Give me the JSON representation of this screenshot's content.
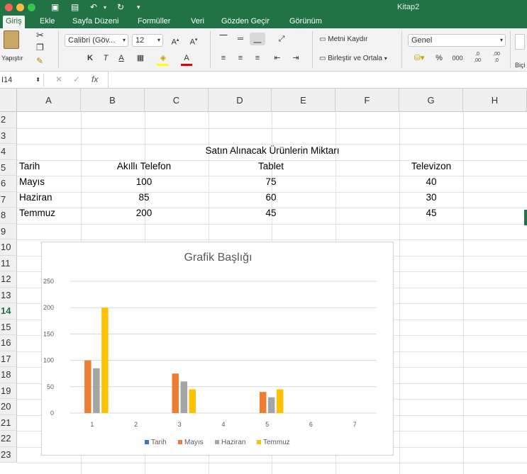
{
  "window": {
    "title": "Kitap2"
  },
  "tabs": [
    "Giriş",
    "Ekle",
    "Sayfa Düzeni",
    "Formüller",
    "Veri",
    "Gözden Geçir",
    "Görünüm"
  ],
  "ribbon": {
    "paste_label": "Yapıştır",
    "font_name": "Calibri (Göv...",
    "font_size": "12",
    "bold": "K",
    "italic": "T",
    "underline": "A",
    "wrap_text": "Metni Kaydır",
    "merge_center": "Birleştir ve Ortala",
    "number_format": "Genel",
    "percent": "%",
    "thousands": "000",
    "decimals_inc": ",0\n,00",
    "decimals_dec": ",00\n,0",
    "styles_label": "Biçi"
  },
  "formula_bar": {
    "name_box": "I14",
    "fx": "fx",
    "content": ""
  },
  "columns": [
    "A",
    "B",
    "C",
    "D",
    "E",
    "F",
    "G",
    "H"
  ],
  "rows": [
    "2",
    "3",
    "4",
    "5",
    "6",
    "7",
    "8",
    "9",
    "10",
    "11",
    "12",
    "13",
    "14",
    "15",
    "16",
    "17",
    "18",
    "19",
    "20",
    "21",
    "22",
    "23"
  ],
  "selected_row": "14",
  "table": {
    "title": "Satın Alınacak Ürünlerin Miktarı",
    "headers": [
      "Tarih",
      "Akıllı Telefon",
      "Tablet",
      "Televizon"
    ],
    "data": [
      [
        "Mayıs",
        "100",
        "75",
        "40"
      ],
      [
        "Haziran",
        "85",
        "60",
        "30"
      ],
      [
        "Temmuz",
        "200",
        "45",
        "45"
      ]
    ]
  },
  "colors": {
    "excel_green": "#217346",
    "tarih": "#4472C4",
    "mayis": "#ED7D31",
    "haziran": "#A5A5A5",
    "temmuz": "#FFC000"
  },
  "chart_data": {
    "type": "bar",
    "title": "Grafik Başlığı",
    "categories": [
      "1",
      "2",
      "3",
      "4",
      "5",
      "6",
      "7"
    ],
    "ylim": [
      0,
      250
    ],
    "yticks": [
      0,
      50,
      100,
      150,
      200,
      250
    ],
    "grid": true,
    "legend_position": "bottom",
    "series": [
      {
        "name": "Tarih",
        "color": "#4472C4",
        "values": [
          0,
          0,
          0,
          0,
          0,
          0,
          0
        ]
      },
      {
        "name": "Mayıs",
        "color": "#ED7D31",
        "values": [
          100,
          null,
          75,
          null,
          40,
          null,
          null
        ]
      },
      {
        "name": "Haziran",
        "color": "#A5A5A5",
        "values": [
          85,
          null,
          60,
          null,
          30,
          null,
          null
        ]
      },
      {
        "name": "Temmuz",
        "color": "#FFC000",
        "values": [
          200,
          null,
          45,
          null,
          45,
          null,
          null
        ]
      }
    ]
  }
}
